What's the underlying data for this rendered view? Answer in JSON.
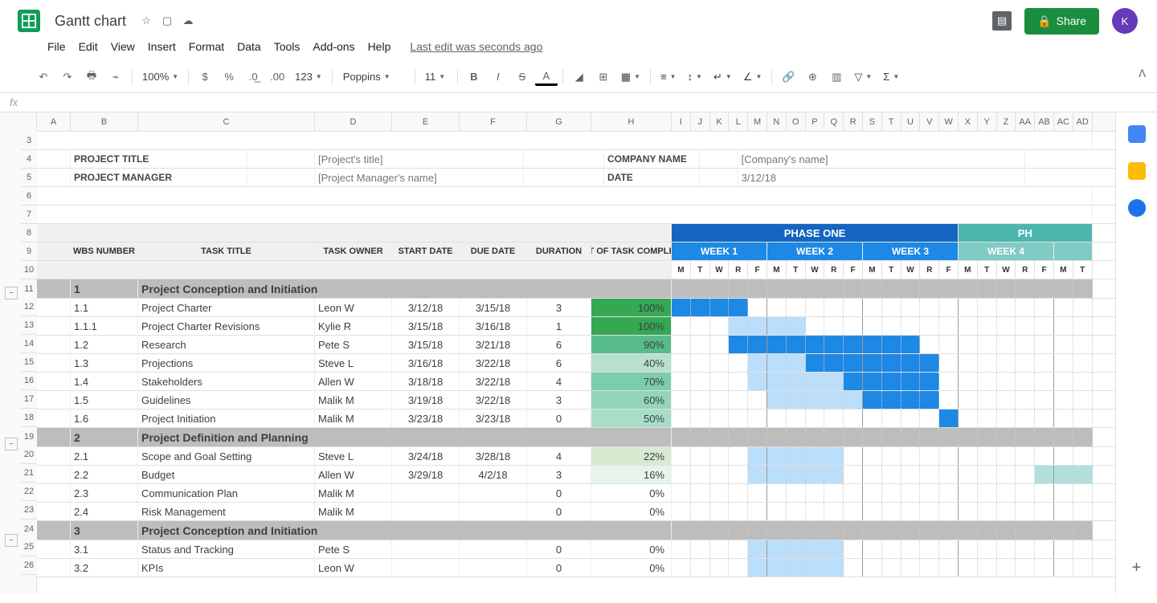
{
  "doc": {
    "title": "Gantt chart",
    "last_edit": "Last edit was seconds ago"
  },
  "menu": [
    "File",
    "Edit",
    "View",
    "Insert",
    "Format",
    "Data",
    "Tools",
    "Add-ons",
    "Help"
  ],
  "toolbar": {
    "zoom": "100%",
    "font": "Poppins",
    "size": "11",
    "currency": "$",
    "pct": "%"
  },
  "share": "Share",
  "avatar": "K",
  "meta": {
    "project_title_label": "PROJECT TITLE",
    "project_title_val": "[Project's title]",
    "company_label": "COMPANY NAME",
    "company_val": "[Company's name]",
    "pm_label": "PROJECT MANAGER",
    "pm_val": "[Project Manager's name]",
    "date_label": "DATE",
    "date_val": "3/12/18"
  },
  "headers": {
    "wbs": "WBS NUMBER",
    "task": "TASK TITLE",
    "owner": "TASK OWNER",
    "start": "START DATE",
    "due": "DUE DATE",
    "dur": "DURATION",
    "pct": "PCT OF TASK COMPLETE",
    "phase1": "PHASE ONE",
    "phase2": "PH"
  },
  "weeks": [
    "WEEK 1",
    "WEEK 2",
    "WEEK 3",
    "WEEK 4"
  ],
  "days": [
    "M",
    "T",
    "W",
    "R",
    "F"
  ],
  "cols": [
    "A",
    "B",
    "C",
    "D",
    "E",
    "F",
    "G",
    "H",
    "I",
    "J",
    "K",
    "L",
    "M",
    "N",
    "O",
    "P",
    "Q",
    "R",
    "S",
    "T",
    "U",
    "V",
    "W",
    "X",
    "Y",
    "Z",
    "AA",
    "AB",
    "AC",
    "AD"
  ],
  "row_start": 3,
  "sections": [
    {
      "num": "1",
      "title": "Project Conception and Initiation",
      "rows": [
        {
          "wbs": "1.1",
          "task": "Project Charter",
          "owner": "Leon W",
          "start": "3/12/18",
          "due": "3/15/18",
          "dur": "3",
          "pct": "100%",
          "pctbg": "#34a853",
          "bar": [
            0,
            4,
            "dark"
          ]
        },
        {
          "wbs": "1.1.1",
          "task": "Project Charter Revisions",
          "owner": "Kylie R",
          "start": "3/15/18",
          "due": "3/16/18",
          "dur": "1",
          "pct": "100%",
          "pctbg": "#34a853",
          "bar": [
            3,
            7,
            "light"
          ]
        },
        {
          "wbs": "1.2",
          "task": "Research",
          "owner": "Pete S",
          "start": "3/15/18",
          "due": "3/21/18",
          "dur": "6",
          "pct": "90%",
          "pctbg": "#57bb8a",
          "bar": [
            3,
            13,
            "dark"
          ],
          "extra": [
            [
              7,
              13,
              "dark"
            ]
          ]
        },
        {
          "wbs": "1.3",
          "task": "Projections",
          "owner": "Steve L",
          "start": "3/16/18",
          "due": "3/22/18",
          "dur": "6",
          "pct": "40%",
          "pctbg": "#b7e1cd",
          "bar": [
            4,
            14,
            "light"
          ],
          "extra": [
            [
              7,
              14,
              "dark"
            ]
          ]
        },
        {
          "wbs": "1.4",
          "task": "Stakeholders",
          "owner": "Allen W",
          "start": "3/18/18",
          "due": "3/22/18",
          "dur": "4",
          "pct": "70%",
          "pctbg": "#7cccae",
          "bar": [
            4,
            14,
            "light"
          ],
          "extra": [
            [
              9,
              14,
              "dark"
            ]
          ]
        },
        {
          "wbs": "1.5",
          "task": "Guidelines",
          "owner": "Malik M",
          "start": "3/19/18",
          "due": "3/22/18",
          "dur": "3",
          "pct": "60%",
          "pctbg": "#93d5bb",
          "bar": [
            5,
            14,
            "light"
          ],
          "extra": [
            [
              10,
              14,
              "dark"
            ]
          ]
        },
        {
          "wbs": "1.6",
          "task": "Project Initiation",
          "owner": "Malik M",
          "start": "3/23/18",
          "due": "3/23/18",
          "dur": "0",
          "pct": "50%",
          "pctbg": "#a8ddc8",
          "bar": [
            14,
            15,
            "dark"
          ]
        }
      ]
    },
    {
      "num": "2",
      "title": "Project Definition and Planning",
      "rows": [
        {
          "wbs": "2.1",
          "task": "Scope and Goal Setting",
          "owner": "Steve L",
          "start": "3/24/18",
          "due": "3/28/18",
          "dur": "4",
          "pct": "22%",
          "pctbg": "#d9ead3",
          "bar": [
            4,
            9,
            "light"
          ]
        },
        {
          "wbs": "2.2",
          "task": "Budget",
          "owner": "Allen W",
          "start": "3/29/18",
          "due": "4/2/18",
          "dur": "3",
          "pct": "16%",
          "pctbg": "#e6f4ea",
          "bar": [
            4,
            9,
            "light"
          ],
          "extra": [
            [
              19,
              22,
              "teal"
            ]
          ]
        },
        {
          "wbs": "2.3",
          "task": "Communication Plan",
          "owner": "Malik M",
          "start": "",
          "due": "",
          "dur": "0",
          "pct": "0%",
          "pctbg": "#fff"
        },
        {
          "wbs": "2.4",
          "task": "Risk Management",
          "owner": "Malik M",
          "start": "",
          "due": "",
          "dur": "0",
          "pct": "0%",
          "pctbg": "#fff"
        }
      ]
    },
    {
      "num": "3",
      "title": "Project Conception and Initiation",
      "rows": [
        {
          "wbs": "3.1",
          "task": "Status and Tracking",
          "owner": "Pete S",
          "start": "",
          "due": "",
          "dur": "0",
          "pct": "0%",
          "pctbg": "#fff",
          "bar": [
            4,
            9,
            "light"
          ]
        },
        {
          "wbs": "3.2",
          "task": "KPIs",
          "owner": "Leon W",
          "start": "",
          "due": "",
          "dur": "0",
          "pct": "0%",
          "pctbg": "#fff",
          "bar": [
            4,
            9,
            "light"
          ]
        }
      ]
    }
  ]
}
